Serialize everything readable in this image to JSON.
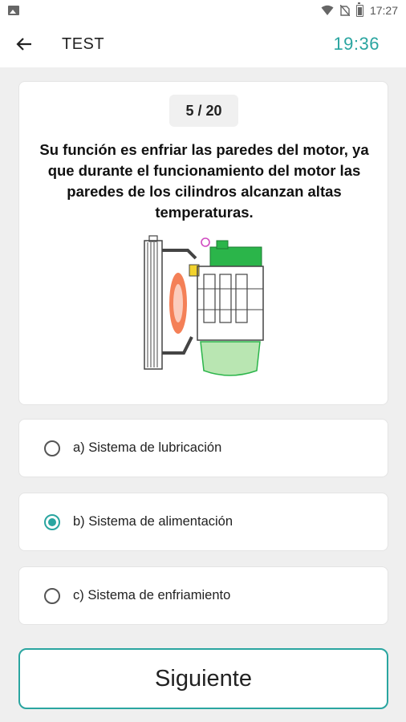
{
  "status_bar": {
    "time": "17:27"
  },
  "header": {
    "title": "TEST",
    "timer": "19:36"
  },
  "question": {
    "counter": "5 / 20",
    "text": "Su función es enfriar las paredes del motor, ya que durante el funcionamiento del motor las paredes de los cilindros alcanzan altas temperaturas."
  },
  "options": [
    {
      "label": "a) Sistema de lubricación",
      "selected": false
    },
    {
      "label": "b) Sistema de alimentación",
      "selected": true
    },
    {
      "label": "c) Sistema de enfriamiento",
      "selected": false
    }
  ],
  "next_button": {
    "label": "Siguiente"
  },
  "colors": {
    "accent": "#2aa5a0"
  }
}
